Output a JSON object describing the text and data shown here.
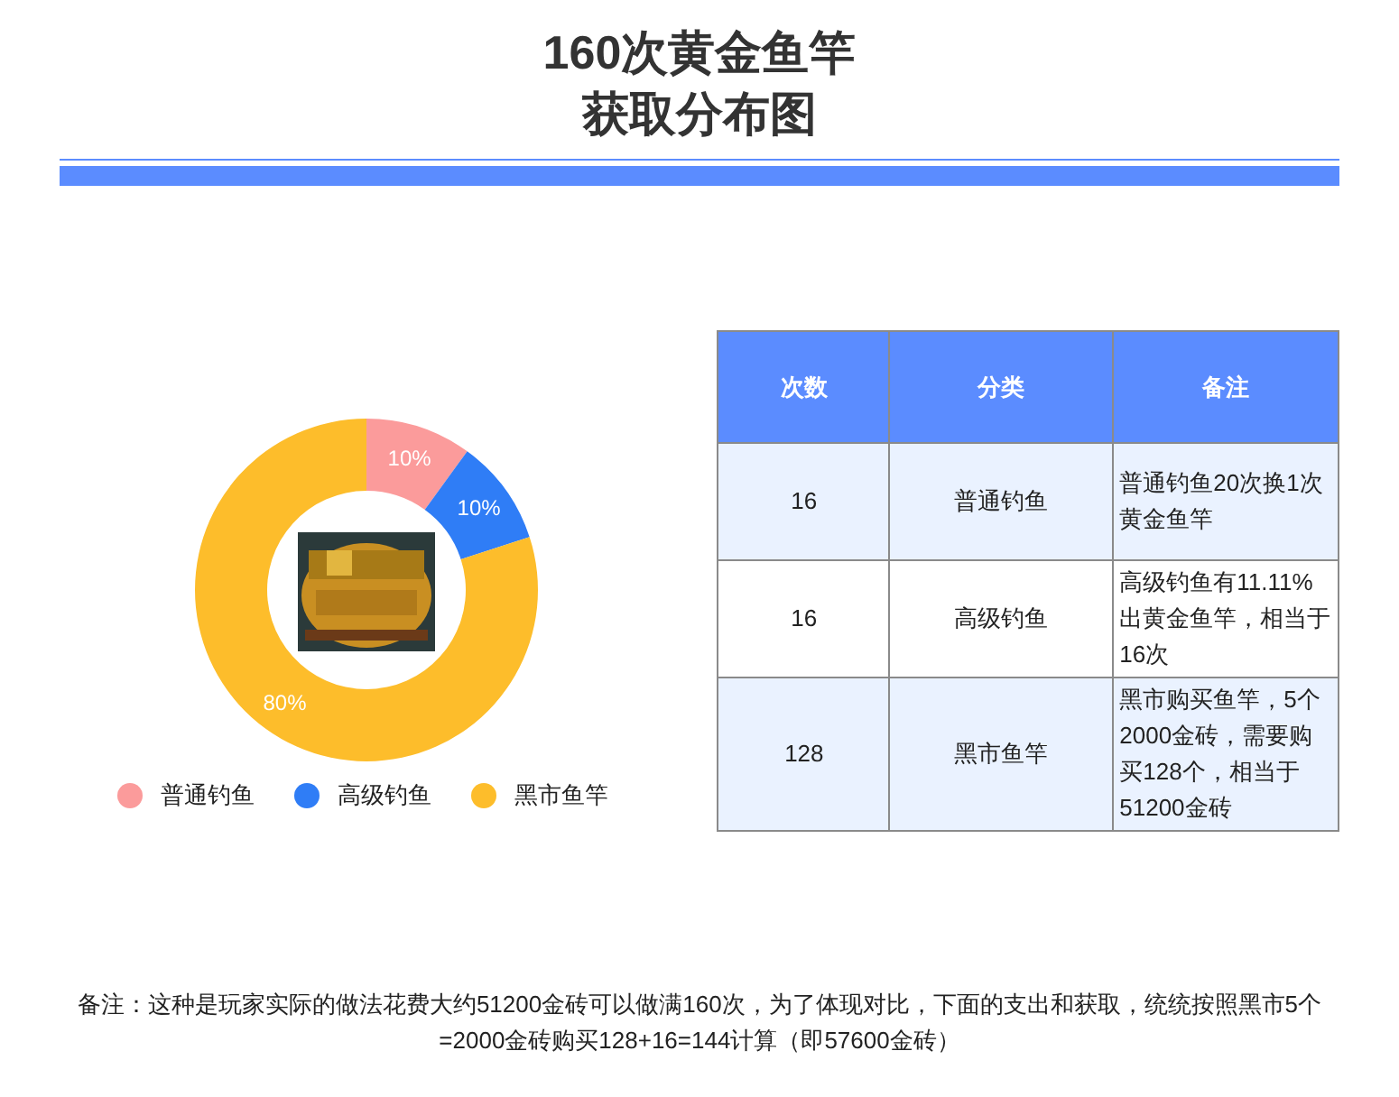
{
  "title_lines": [
    "160次黄金鱼竿",
    "获取分布图"
  ],
  "chart": {
    "chart_data": {
      "type": "donut",
      "categories": [
        "普通钓鱼",
        "高级钓鱼",
        "黑市鱼竿"
      ],
      "values": [
        10,
        10,
        80
      ],
      "colors": [
        "#fb9b9b",
        "#2f7df6",
        "#fdbd2b"
      ],
      "value_labels": [
        "10%",
        "10%",
        "80%"
      ]
    }
  },
  "table": {
    "columns": [
      "次数",
      "分类",
      "备注"
    ],
    "rows": [
      {
        "cells": [
          "16",
          "普通钓鱼",
          "普通钓鱼20次换1次黄金鱼竿"
        ]
      },
      {
        "cells": [
          "16",
          "高级钓鱼",
          "高级钓鱼有11.11%出黄金鱼竿，相当于16次"
        ]
      },
      {
        "cells": [
          "128",
          "黑市鱼竿",
          "黑市购买鱼竿，5个2000金砖，需要购买128个，相当于51200金砖"
        ]
      }
    ]
  },
  "note": "备注：这种是玩家实际的做法花费大约51200金砖可以做满160次，为了体现对比，下面的支出和获取，统统按照黑市5个=2000金砖购买128+16=144计算（即57600金砖）"
}
